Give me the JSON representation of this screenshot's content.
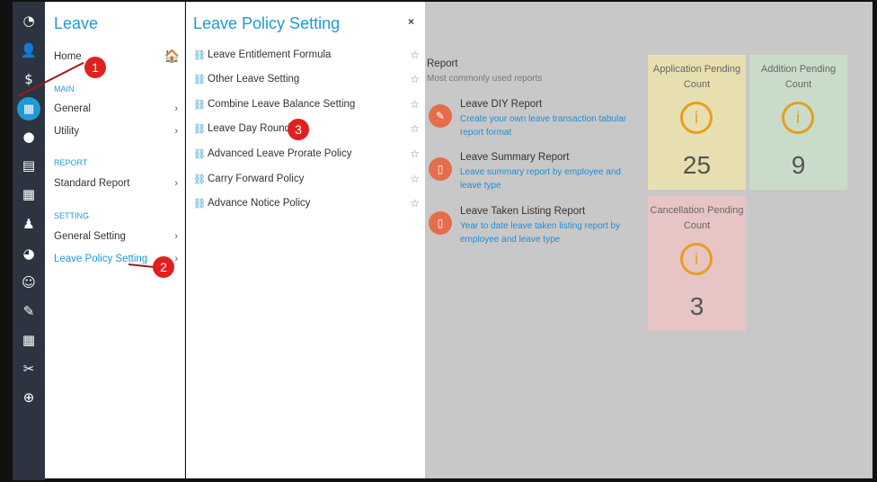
{
  "rail": {
    "icons": [
      "dashboard-icon",
      "user-add-icon",
      "dollar-icon",
      "calendar-icon",
      "clock-icon",
      "document-icon",
      "calendar-plus-icon",
      "person-icon",
      "pie-chart-icon",
      "smile-icon",
      "clipboard-icon",
      "table-icon",
      "tools-icon",
      "upload-icon"
    ],
    "glyphs": [
      "◔",
      "👤",
      "$",
      "▦",
      "●",
      "▤",
      "▦",
      "♟",
      "◕",
      "☺",
      "✎",
      "▦",
      "✂",
      "⊕"
    ]
  },
  "leave_panel": {
    "title": "Leave",
    "home": "Home",
    "section_main": "MAIN",
    "general": "General",
    "utility": "Utility",
    "section_report": "REPORT",
    "standard_report": "Standard Report",
    "section_setting": "SETTING",
    "general_setting": "General Setting",
    "leave_policy_setting": "Leave Policy Setting"
  },
  "policy_panel": {
    "title": "Leave Policy Setting",
    "close": "×",
    "items": [
      "Leave Entitlement Formula",
      "Other Leave Setting",
      "Combine Leave Balance Setting",
      "Leave Day Rounding",
      "Advanced Leave Prorate Policy",
      "Carry Forward Policy",
      "Advance Notice Policy"
    ]
  },
  "report": {
    "heading": "Report",
    "subheading": "Most commonly used reports",
    "items": [
      {
        "title": "Leave DIY Report",
        "desc": "Create your own leave transaction tabular report format",
        "icon": "pencil-icon"
      },
      {
        "title": "Leave Summary Report",
        "desc": "Leave summary report by employee and leave type",
        "icon": "file-icon"
      },
      {
        "title": "Leave Taken Listing Report",
        "desc": "Year to date leave taken listing report by employee and leave type",
        "icon": "file-icon"
      }
    ]
  },
  "cards": [
    {
      "label": "Application Pending Count",
      "value": "25",
      "color": "#e8dfb0"
    },
    {
      "label": "Addition Pending Count",
      "value": "9",
      "color": "#c9dcc9"
    },
    {
      "label": "Cancellation Pending Count",
      "value": "3",
      "color": "#e7c5c5"
    }
  ],
  "annotations": [
    "1",
    "2",
    "3"
  ],
  "colors": {
    "accent": "#1f9ad6",
    "badge": "#e0201e",
    "report_icon": "#e46d4b",
    "info_ring": "#e69f1e"
  }
}
